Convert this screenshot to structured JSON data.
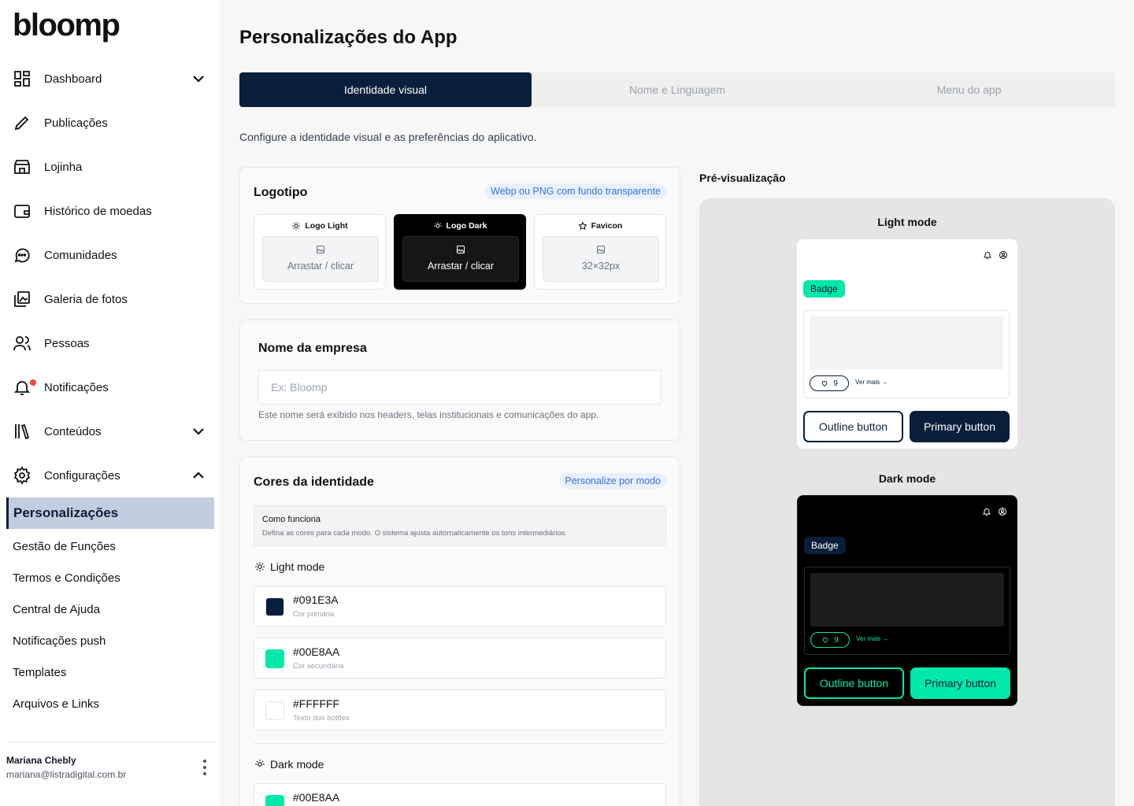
{
  "app": {
    "logo": "bloomp"
  },
  "sidebar": {
    "items": [
      {
        "label": "Dashboard",
        "icon": "grid-icon",
        "expandable": true
      },
      {
        "label": "Publicações",
        "icon": "pencil-icon"
      },
      {
        "label": "Lojinha",
        "icon": "store-icon"
      },
      {
        "label": "Histórico de moedas",
        "icon": "wallet-icon"
      },
      {
        "label": "Comunidades",
        "icon": "chat-icon"
      },
      {
        "label": "Galeria de fotos",
        "icon": "photo-gallery-icon"
      },
      {
        "label": "Pessoas",
        "icon": "people-icon"
      },
      {
        "label": "Notificações",
        "icon": "bell-icon"
      },
      {
        "label": "Conteúdos",
        "icon": "library-icon",
        "expandable": true
      },
      {
        "label": "Configurações",
        "icon": "gear-icon",
        "expanded": true
      }
    ],
    "sub_items": [
      {
        "label": "Personalizações",
        "active": true
      },
      {
        "label": "Gestão de Funções"
      },
      {
        "label": "Termos e Condições"
      },
      {
        "label": "Central de Ajuda"
      },
      {
        "label": "Notificações push"
      },
      {
        "label": "Templates"
      },
      {
        "label": "Arquivos e Links"
      }
    ],
    "user": {
      "name": "Mariana Chebly",
      "email": "mariana@listradigital.com.br"
    }
  },
  "main": {
    "title": "Personalizações do App",
    "tabs": [
      {
        "label": "Identidade visual",
        "active": true
      },
      {
        "label": "Nome e Linguagem"
      },
      {
        "label": "Menu do app"
      }
    ],
    "subtitle": "Configure a identidade visual e as preferências do aplicativo.",
    "logo_card": {
      "title": "Logotipo",
      "hint": "Webp ou PNG com fundo transparente",
      "boxes": [
        {
          "label": "Logo Light",
          "drop": "Arrastar / clicar"
        },
        {
          "label": "Logo Dark",
          "drop": "Arrastar / clicar"
        },
        {
          "label": "Favicon",
          "drop": "32×32px"
        }
      ]
    },
    "company_card": {
      "title": "Nome da empresa",
      "placeholder": "Ex: Bloomp",
      "helper": "Este nome será exibido nos headers, telas institucionais e comunicações do app."
    },
    "colors_card": {
      "title": "Cores da identidade",
      "hint": "Personalize por modo",
      "info_title": "Como funciona",
      "info_text": "Defina as cores para cada modo. O sistema ajusta automaticamente os tons intermediários.",
      "light_label": "Light mode",
      "dark_label": "Dark mode",
      "light_colors": [
        {
          "hex": "#091E3A",
          "label": "Cor primária",
          "color": "#091e3a"
        },
        {
          "hex": "#00E8AA",
          "label": "Cor secundária",
          "color": "#00e8aa"
        },
        {
          "hex": "#FFFFFF",
          "label": "Texto dos botões",
          "color": "#ffffff"
        }
      ],
      "dark_colors": [
        {
          "hex": "#00E8AA",
          "color": "#00e8aa"
        }
      ]
    }
  },
  "preview": {
    "title": "Pré-visualização",
    "light_title": "Light mode",
    "dark_title": "Dark mode",
    "badge": "Badge",
    "like_count": "9",
    "see_more": "Ver mais →",
    "outline_button": "Outline button",
    "primary_button": "Primary button"
  }
}
